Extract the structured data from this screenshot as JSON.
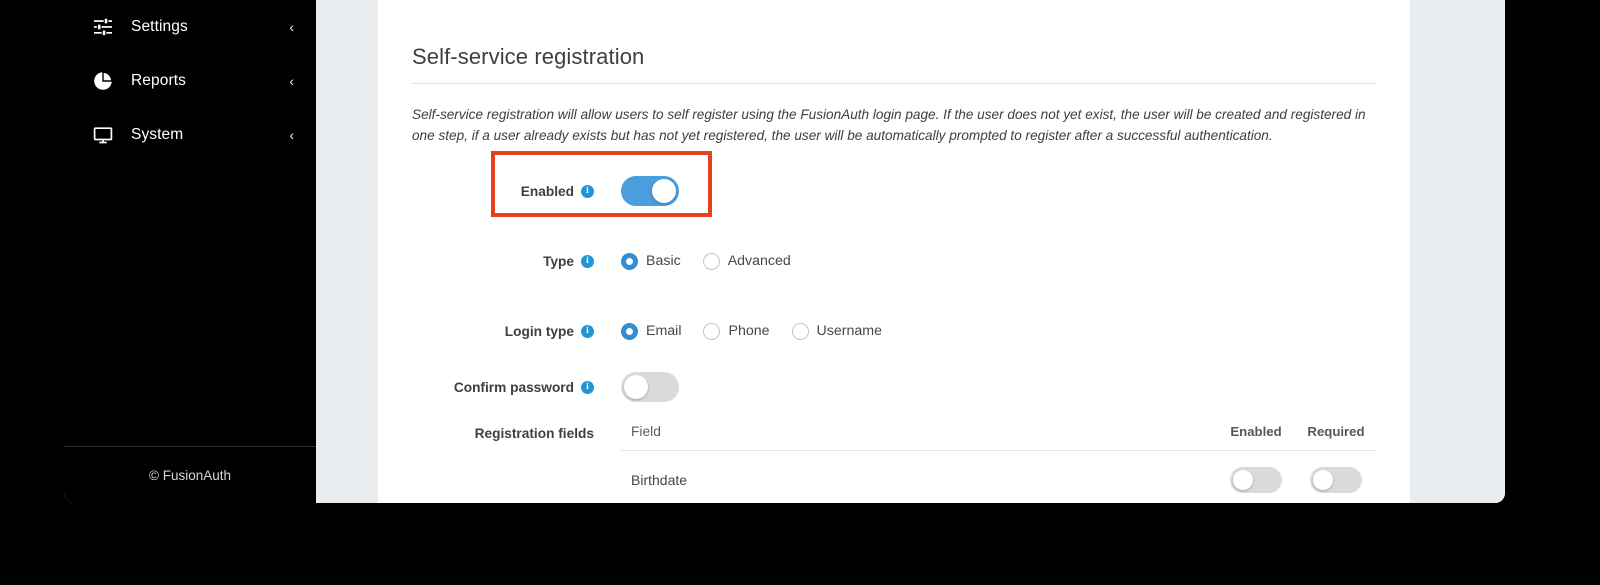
{
  "sidebar": {
    "items": [
      {
        "label": "Settings",
        "icon": "sliders-icon",
        "chevron": "‹"
      },
      {
        "label": "Reports",
        "icon": "pie-chart-icon",
        "chevron": "‹"
      },
      {
        "label": "System",
        "icon": "monitor-icon",
        "chevron": "‹"
      }
    ],
    "footer": "© FusionAuth"
  },
  "page": {
    "title": "Self-service registration",
    "description": "Self-service registration will allow users to self register using the FusionAuth login page. If the user does not yet exist, the user will be created and registered in one step, if a user already exists but has not yet registered, the user will be automatically prompted to register after a successful authentication."
  },
  "form": {
    "enabled": {
      "label": "Enabled",
      "info": "i",
      "state": "on"
    },
    "type": {
      "label": "Type",
      "info": "i",
      "options": [
        {
          "label": "Basic",
          "checked": true
        },
        {
          "label": "Advanced",
          "checked": false
        }
      ]
    },
    "login_type": {
      "label": "Login type",
      "info": "i",
      "options": [
        {
          "label": "Email",
          "checked": true
        },
        {
          "label": "Phone",
          "checked": false
        },
        {
          "label": "Username",
          "checked": false
        }
      ]
    },
    "confirm_password": {
      "label": "Confirm password",
      "info": "i",
      "state": "off"
    },
    "registration_fields": {
      "label": "Registration fields",
      "columns": {
        "field": "Field",
        "enabled": "Enabled",
        "required": "Required"
      },
      "rows": [
        {
          "field": "Birthdate",
          "enabled": "off",
          "required": "off"
        }
      ]
    }
  },
  "colors": {
    "accent_blue": "#4a9ede",
    "info_blue": "#2196d6",
    "highlight_red": "#e8401f",
    "sidebar_bg": "#000000",
    "gutter_bg": "#e9edf0"
  }
}
